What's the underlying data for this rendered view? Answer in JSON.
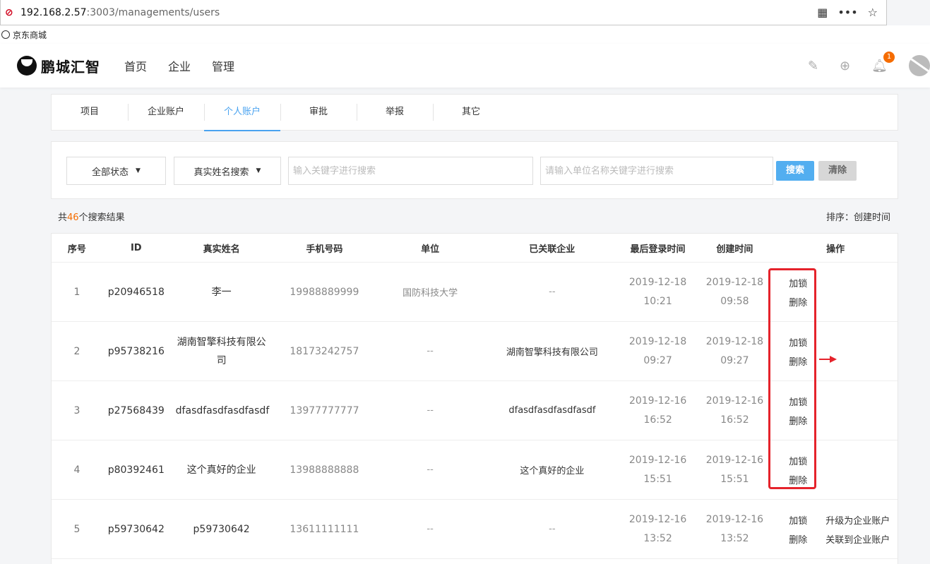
{
  "browser": {
    "url_host": "192.168.2.57",
    "url_rest": ":3003/managements/users",
    "bookmark": "京东商城"
  },
  "header": {
    "brand": "鹏城汇智",
    "nav": [
      "首页",
      "企业",
      "管理"
    ],
    "notification_count": "1"
  },
  "tabs": [
    "项目",
    "企业账户",
    "个人账户",
    "审批",
    "举报",
    "其它"
  ],
  "active_tab": "个人账户",
  "filters": {
    "status_label": "全部状态",
    "field_label": "真实姓名搜索",
    "keyword_placeholder": "输入关键字进行搜索",
    "org_placeholder": "请输入单位名称关键字进行搜索",
    "search_label": "搜索",
    "clear_label": "清除"
  },
  "results": {
    "prefix": "共",
    "count": "46",
    "suffix": "个搜索结果",
    "sort_label": "排序：创建时间"
  },
  "table": {
    "headers": [
      "序号",
      "ID",
      "真实姓名",
      "手机号码",
      "单位",
      "已关联企业",
      "最后登录时间",
      "创建时间",
      "操作"
    ],
    "rows": [
      {
        "no": "1",
        "id": "p20946518",
        "name": "李一",
        "phone": "19988889999",
        "org": "国防科技大学",
        "company": "--",
        "login_date": "2019-12-18",
        "login_time": "10:21",
        "created_date": "2019-12-18",
        "created_time": "09:58",
        "op1": "加锁",
        "op2": "删除",
        "op3": "",
        "op4": ""
      },
      {
        "no": "2",
        "id": "p95738216",
        "name": "湖南智擎科技有限公司",
        "phone": "18173242757",
        "org": "--",
        "company": "湖南智擎科技有限公司",
        "login_date": "2019-12-18",
        "login_time": "09:27",
        "created_date": "2019-12-18",
        "created_time": "09:27",
        "op1": "加锁",
        "op2": "删除",
        "op3": "",
        "op4": ""
      },
      {
        "no": "3",
        "id": "p27568439",
        "name": "dfasdfasdfasdfasdf",
        "phone": "13977777777",
        "org": "--",
        "company": "dfasdfasdfasdfasdf",
        "login_date": "2019-12-16",
        "login_time": "16:52",
        "created_date": "2019-12-16",
        "created_time": "16:52",
        "op1": "加锁",
        "op2": "删除",
        "op3": "",
        "op4": ""
      },
      {
        "no": "4",
        "id": "p80392461",
        "name": "这个真好的企业",
        "phone": "13988888888",
        "org": "--",
        "company": "这个真好的企业",
        "login_date": "2019-12-16",
        "login_time": "15:51",
        "created_date": "2019-12-16",
        "created_time": "15:51",
        "op1": "加锁",
        "op2": "删除",
        "op3": "",
        "op4": ""
      },
      {
        "no": "5",
        "id": "p59730642",
        "name": "p59730642",
        "phone": "13611111111",
        "org": "--",
        "company": "--",
        "login_date": "2019-12-16",
        "login_time": "13:52",
        "created_date": "2019-12-16",
        "created_time": "13:52",
        "op1": "加锁",
        "op2": "删除",
        "op3": "升级为企业账户",
        "op4": "关联到企业账户"
      }
    ]
  },
  "colors": {
    "accent": "#4aa3f0",
    "highlight_box": "#e5232b",
    "count_color": "#f56c00"
  }
}
